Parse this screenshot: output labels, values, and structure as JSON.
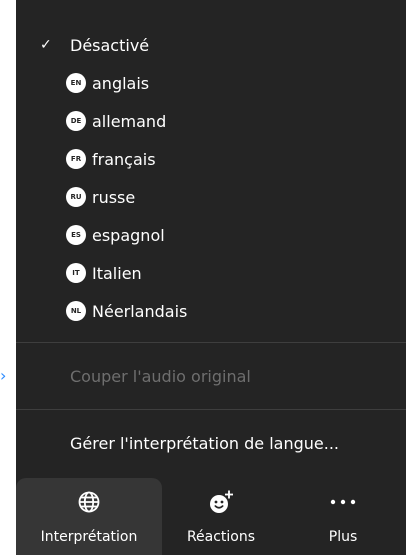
{
  "menu": {
    "check_symbol": "✓",
    "items": [
      {
        "label": "Désactivé",
        "checked": true
      },
      {
        "label": "anglais",
        "badge": "EN"
      },
      {
        "label": "allemand",
        "badge": "DE"
      },
      {
        "label": "français",
        "badge": "FR"
      },
      {
        "label": "russe",
        "badge": "RU"
      },
      {
        "label": "espagnol",
        "badge": "ES"
      },
      {
        "label": "Italien",
        "badge": "IT"
      },
      {
        "label": "Néerlandais",
        "badge": "NL"
      }
    ]
  },
  "actions": {
    "mute_original": "Couper l'audio original",
    "manage": "Gérer l'interprétation de langue..."
  },
  "toolbar": {
    "interpretation": "Interprétation",
    "reactions": "Réactions",
    "more": "Plus"
  },
  "colors": {
    "panel_bg": "#242424",
    "active_button_bg": "#363636",
    "disabled_text": "#6e6e6e",
    "accent": "#2D8CFF"
  }
}
